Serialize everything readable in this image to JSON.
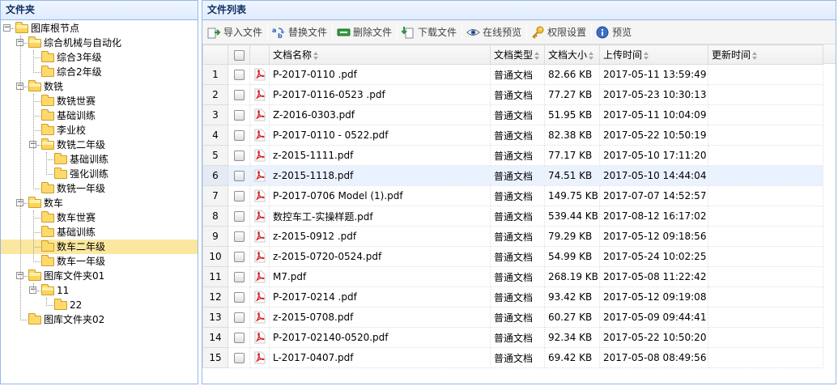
{
  "left_panel": {
    "title": "文件夹",
    "tree": [
      {
        "label": "图库根节点",
        "depth": 0,
        "expanded": true,
        "has_children": true
      },
      {
        "label": "综合机械与自动化",
        "depth": 1,
        "expanded": true,
        "has_children": true
      },
      {
        "label": "综合3年级",
        "depth": 2,
        "has_children": false
      },
      {
        "label": "综合2年级",
        "depth": 2,
        "has_children": false
      },
      {
        "label": "数铣",
        "depth": 1,
        "expanded": true,
        "has_children": true
      },
      {
        "label": "数铣世赛",
        "depth": 2,
        "has_children": false
      },
      {
        "label": "基础训练",
        "depth": 2,
        "has_children": false
      },
      {
        "label": "李业校",
        "depth": 2,
        "has_children": false
      },
      {
        "label": "数铣二年级",
        "depth": 2,
        "expanded": true,
        "has_children": true
      },
      {
        "label": "基础训练",
        "depth": 3,
        "has_children": false
      },
      {
        "label": "强化训练",
        "depth": 3,
        "has_children": false
      },
      {
        "label": "数铣一年级",
        "depth": 2,
        "has_children": false
      },
      {
        "label": "数车",
        "depth": 1,
        "expanded": true,
        "has_children": true
      },
      {
        "label": "数车世赛",
        "depth": 2,
        "has_children": false
      },
      {
        "label": "基础训练",
        "depth": 2,
        "has_children": false
      },
      {
        "label": "数车二年级",
        "depth": 2,
        "has_children": false,
        "selected": true
      },
      {
        "label": "数车一年级",
        "depth": 2,
        "has_children": false
      },
      {
        "label": "图库文件夹01",
        "depth": 1,
        "expanded": true,
        "has_children": true
      },
      {
        "label": "11",
        "depth": 2,
        "expanded": true,
        "has_children": true
      },
      {
        "label": "22",
        "depth": 3,
        "has_children": false
      },
      {
        "label": "图库文件夹02",
        "depth": 1,
        "has_children": false
      }
    ]
  },
  "right_panel": {
    "title": "文件列表",
    "toolbar": [
      {
        "label": "导入文件",
        "icon": "import-icon"
      },
      {
        "label": "替换文件",
        "icon": "replace-icon"
      },
      {
        "label": "删除文件",
        "icon": "delete-icon"
      },
      {
        "label": "下载文件",
        "icon": "download-icon"
      },
      {
        "label": "在线预览",
        "icon": "eye-icon"
      },
      {
        "label": "权限设置",
        "icon": "key-icon"
      },
      {
        "label": "预览",
        "icon": "info-icon"
      }
    ],
    "columns": [
      "文档名称",
      "文档类型",
      "文档大小",
      "上传时间",
      "更新时间"
    ],
    "rows": [
      {
        "no": "1",
        "name": "P-2017-0110 .pdf",
        "type": "普通文档",
        "size": "82.66 KB",
        "uploaded": "2017-05-11 13:59:49",
        "updated": ""
      },
      {
        "no": "2",
        "name": "P-2017-0116-0523 .pdf",
        "type": "普通文档",
        "size": "77.27 KB",
        "uploaded": "2017-05-23 10:30:13",
        "updated": ""
      },
      {
        "no": "3",
        "name": "Z-2016-0303.pdf",
        "type": "普通文档",
        "size": "51.95 KB",
        "uploaded": "2017-05-11 10:04:09",
        "updated": ""
      },
      {
        "no": "4",
        "name": "P-2017-0110 - 0522.pdf",
        "type": "普通文档",
        "size": "82.38 KB",
        "uploaded": "2017-05-22 10:50:19",
        "updated": ""
      },
      {
        "no": "5",
        "name": "z-2015-1111.pdf",
        "type": "普通文档",
        "size": "77.17 KB",
        "uploaded": "2017-05-10 17:11:20",
        "updated": ""
      },
      {
        "no": "6",
        "name": "z-2015-1118.pdf",
        "type": "普通文档",
        "size": "74.51 KB",
        "uploaded": "2017-05-10 14:44:04",
        "updated": "",
        "hover": true
      },
      {
        "no": "7",
        "name": "P-2017-0706 Model (1).pdf",
        "type": "普通文档",
        "size": "149.75 KB",
        "uploaded": "2017-07-07 14:52:57",
        "updated": ""
      },
      {
        "no": "8",
        "name": "数控车工-实操样题.pdf",
        "type": "普通文档",
        "size": "539.44 KB",
        "uploaded": "2017-08-12 16:17:02",
        "updated": ""
      },
      {
        "no": "9",
        "name": "z-2015-0912 .pdf",
        "type": "普通文档",
        "size": "79.29 KB",
        "uploaded": "2017-05-12 09:18:56",
        "updated": ""
      },
      {
        "no": "10",
        "name": "z-2015-0720-0524.pdf",
        "type": "普通文档",
        "size": "54.99 KB",
        "uploaded": "2017-05-24 10:02:25",
        "updated": ""
      },
      {
        "no": "11",
        "name": "M7.pdf",
        "type": "普通文档",
        "size": "268.19 KB",
        "uploaded": "2017-05-08 11:22:42",
        "updated": ""
      },
      {
        "no": "12",
        "name": "P-2017-0214 .pdf",
        "type": "普通文档",
        "size": "93.42 KB",
        "uploaded": "2017-05-12 09:19:08",
        "updated": ""
      },
      {
        "no": "13",
        "name": "z-2015-0708.pdf",
        "type": "普通文档",
        "size": "60.27 KB",
        "uploaded": "2017-05-09 09:44:41",
        "updated": ""
      },
      {
        "no": "14",
        "name": "P-2017-02140-0520.pdf",
        "type": "普通文档",
        "size": "92.34 KB",
        "uploaded": "2017-05-22 10:50:20",
        "updated": ""
      },
      {
        "no": "15",
        "name": "L-2017-0407.pdf",
        "type": "普通文档",
        "size": "69.42 KB",
        "uploaded": "2017-05-08 08:49:56",
        "updated": ""
      }
    ]
  },
  "colors": {
    "panel_border": "#95b8e7",
    "header_text": "#0e2d5f",
    "selected_node": "#fbe7a0",
    "row_hover": "#eaf2ff",
    "pdf_red": "#d8282c",
    "folder_yellow": "#ffd96a"
  }
}
